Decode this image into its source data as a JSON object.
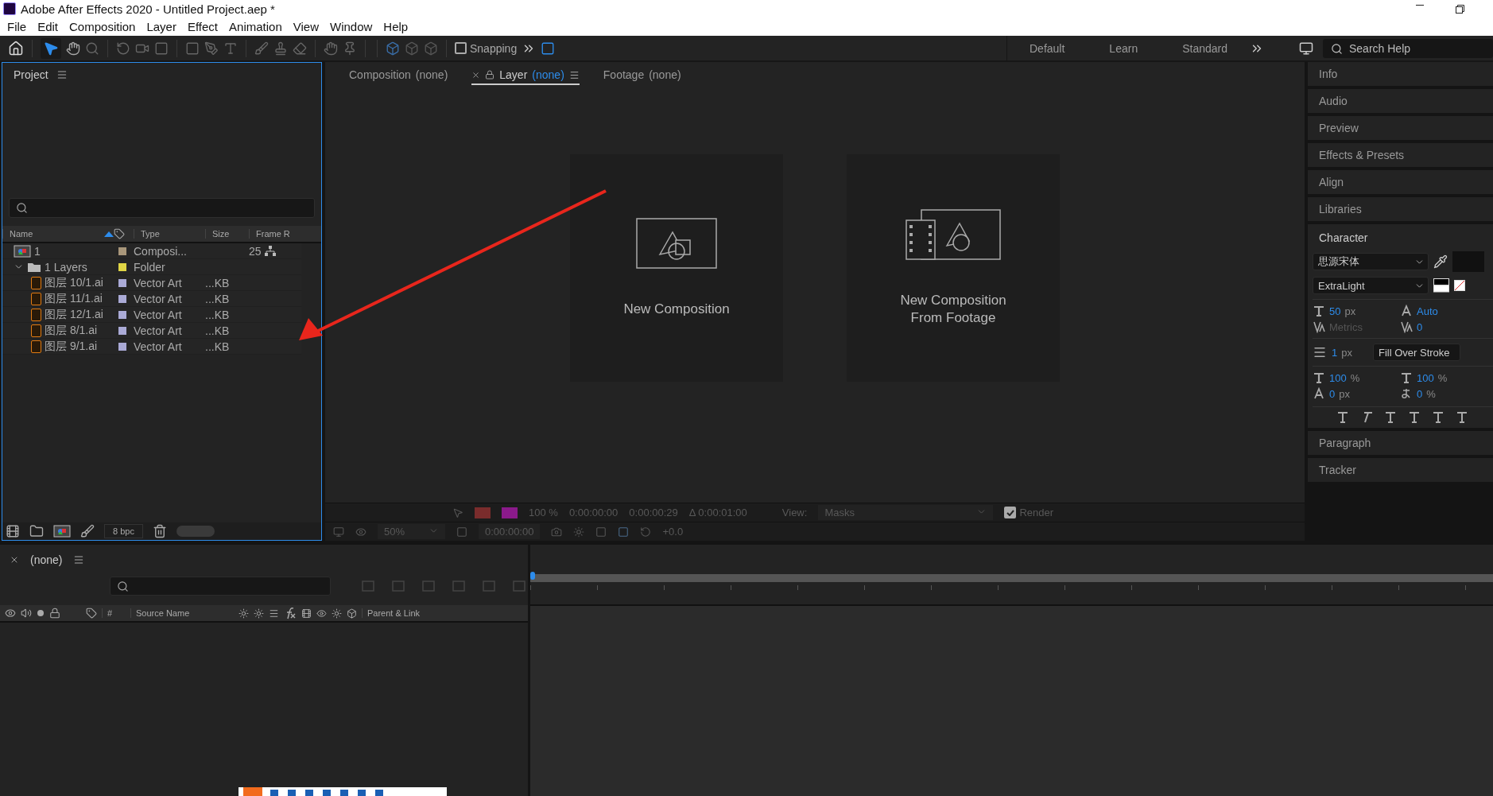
{
  "window": {
    "title": "Adobe After Effects 2020 - Untitled Project.aep *"
  },
  "menu": [
    "File",
    "Edit",
    "Composition",
    "Layer",
    "Effect",
    "Animation",
    "View",
    "Window",
    "Help"
  ],
  "toolbar": {
    "snapping": {
      "label": "Snapping",
      "checked": false
    }
  },
  "workspaces": [
    "Default",
    "Learn",
    "Standard"
  ],
  "search_help": {
    "placeholder": "Search Help"
  },
  "project": {
    "title": "Project",
    "columns": [
      "Name",
      "Type",
      "Size",
      "Frame R"
    ],
    "depth": "8 bpc",
    "items": [
      {
        "kind": "composition",
        "name": "1",
        "color": "#a8967a",
        "type": "Composi...",
        "frame_rate": "25"
      },
      {
        "kind": "folder",
        "name": "1 Layers",
        "color": "#e0d545",
        "type": "Folder",
        "expanded": true,
        "children": [
          {
            "kind": "vector",
            "name": "图层 10/1.ai",
            "color": "#aaaad6",
            "type": "Vector Art",
            "size": "...KB"
          },
          {
            "kind": "vector",
            "name": "图层 11/1.ai",
            "color": "#aaaad6",
            "type": "Vector Art",
            "size": "...KB"
          },
          {
            "kind": "vector",
            "name": "图层 12/1.ai",
            "color": "#aaaad6",
            "type": "Vector Art",
            "size": "...KB"
          },
          {
            "kind": "vector",
            "name": "图层 8/1.ai",
            "color": "#aaaad6",
            "type": "Vector Art",
            "size": "...KB"
          },
          {
            "kind": "vector",
            "name": "图层 9/1.ai",
            "color": "#aaaad6",
            "type": "Vector Art",
            "size": "...KB"
          }
        ]
      }
    ]
  },
  "viewer": {
    "tabs": [
      {
        "label": "Composition",
        "value": "(none)",
        "selected": false
      },
      {
        "label": "Layer",
        "value": "(none)",
        "selected": true
      },
      {
        "label": "Footage",
        "value": "(none)",
        "selected": false
      }
    ],
    "cards": [
      {
        "kind": "composition",
        "lines": [
          "New Composition"
        ]
      },
      {
        "kind": "footage",
        "lines": [
          "New Composition",
          "From Footage"
        ]
      }
    ],
    "layer_bar": {
      "zoom": "100 %",
      "in_point": "0:00:00:00",
      "out_point": "0:00:00:29",
      "duration": "Δ 0:00:01:00",
      "view_label": "View:",
      "view": "Masks",
      "render": {
        "label": "Render",
        "checked": true
      }
    },
    "comp_bar": {
      "magnification": "50%",
      "time": "0:00:00:00",
      "exposure": "+0.0"
    }
  },
  "right_panels": [
    "Info",
    "Audio",
    "Preview",
    "Effects & Presets",
    "Align",
    "Libraries"
  ],
  "character": {
    "title": "Character",
    "font": "思源宋体",
    "style": "ExtraLight",
    "font_size": {
      "value": "50",
      "unit": "px"
    },
    "leading": {
      "value": "Auto"
    },
    "kerning": {
      "value": "Metrics",
      "disabled": true
    },
    "tracking": {
      "value": "0"
    },
    "stroke_width": {
      "value": "1",
      "unit": "px"
    },
    "stroke_mode": "Fill Over Stroke",
    "vertical_scale": {
      "value": "100",
      "unit": "%"
    },
    "horizontal_scale": {
      "value": "100",
      "unit": "%"
    },
    "baseline_shift": {
      "value": "0",
      "unit": "px"
    },
    "tsume": {
      "value": "0",
      "unit": "%"
    }
  },
  "panels_after": [
    "Paragraph",
    "Tracker"
  ],
  "timeline": {
    "comp": "(none)",
    "columns": [
      "#",
      "Source Name",
      "Parent & Link"
    ]
  }
}
